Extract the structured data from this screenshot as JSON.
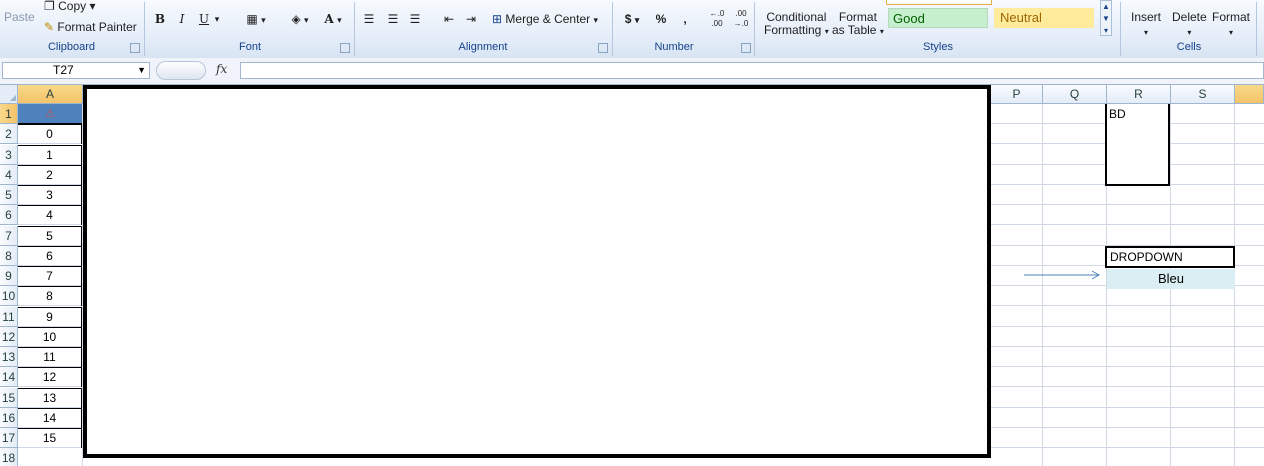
{
  "ribbon": {
    "clipboard": {
      "paste_label": "Paste",
      "copy_label": "Copy",
      "format_painter_label": "Format Painter",
      "group_label": "Clipboard"
    },
    "font": {
      "bold": "B",
      "italic": "I",
      "underline": "U",
      "font_color": "A",
      "group_label": "Font"
    },
    "alignment": {
      "merge_center_label": "Merge & Center",
      "group_label": "Alignment"
    },
    "number": {
      "currency": "$",
      "percent": "%",
      "comma": ",",
      "inc_decimal": "←.0 .00",
      "dec_decimal": ".00 →.0",
      "group_label": "Number"
    },
    "styles": {
      "conditional_formatting_line1": "Conditional",
      "conditional_formatting_line2": "Formatting",
      "format_as_table_line1": "Format",
      "format_as_table_line2": "as Table",
      "good": "Good",
      "neutral": "Neutral",
      "group_label": "Styles"
    },
    "cells": {
      "insert_label": "Insert",
      "delete_label": "Delete",
      "format_label": "Format",
      "group_label": "Cells"
    }
  },
  "formula_bar": {
    "name_box": "T27",
    "fx": "fx",
    "content": ""
  },
  "columns": [
    "A",
    "P",
    "Q",
    "R",
    "S"
  ],
  "rows": [
    "1",
    "2",
    "3",
    "4",
    "5",
    "6",
    "7",
    "8",
    "9",
    "10",
    "11",
    "12",
    "13",
    "14",
    "15",
    "16",
    "17",
    "18"
  ],
  "column_a_values": [
    "",
    "0",
    "1",
    "2",
    "3",
    "4",
    "5",
    "6",
    "7",
    "8",
    "9",
    "10",
    "11",
    "12",
    "13",
    "14",
    "15"
  ],
  "cells": {
    "R1": "BD",
    "R8": "DROPDOWN",
    "R9": "Bleu"
  },
  "colors": {
    "ribbon_text": "#15428b",
    "good_bg": "#c6efce",
    "neutral_bg": "#ffeb9c",
    "dropdown_value_bg": "#daeef3"
  }
}
